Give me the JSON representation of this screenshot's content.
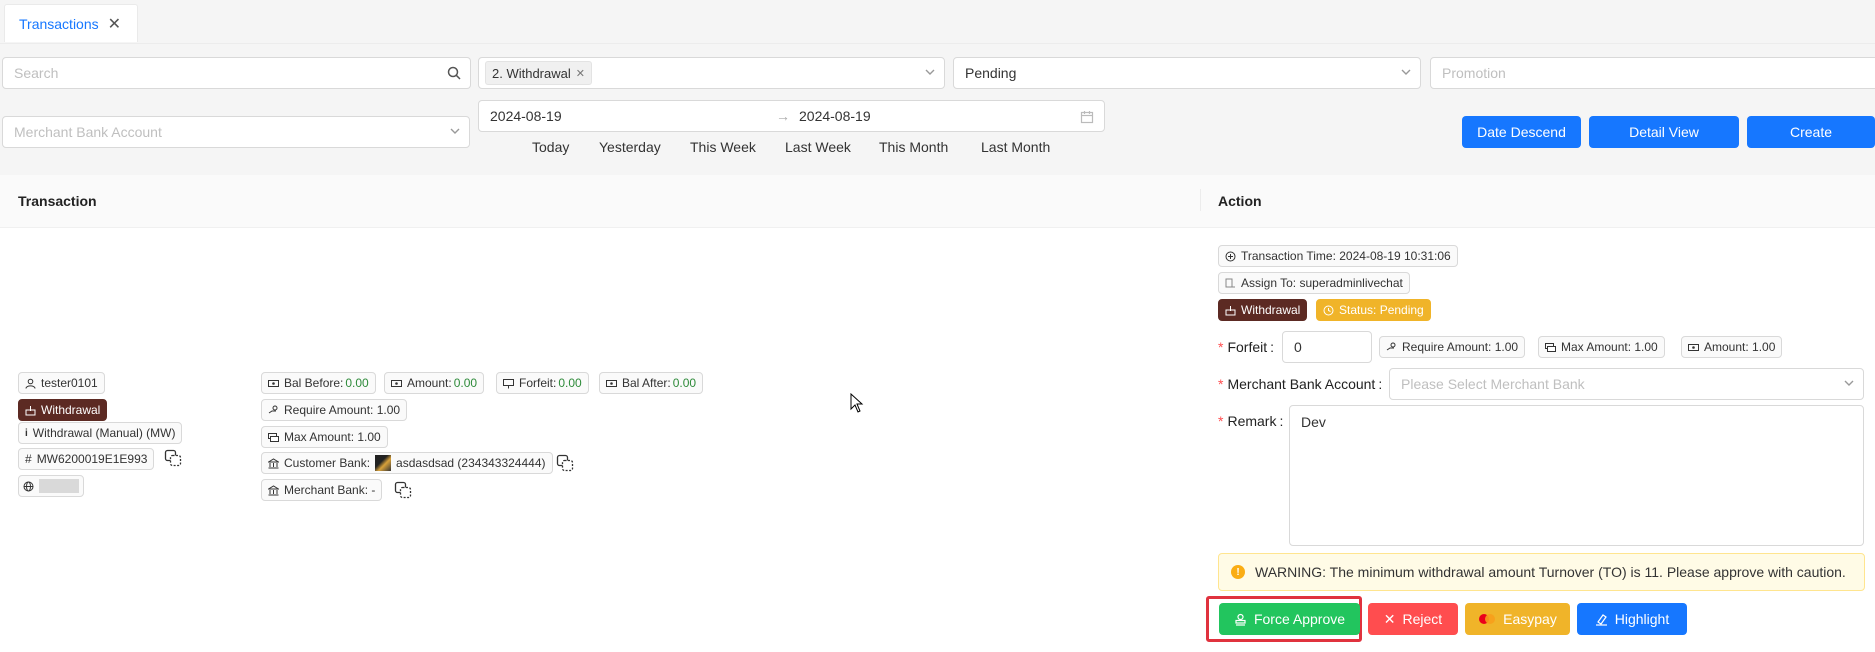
{
  "tab": {
    "label": "Transactions",
    "close": "✕"
  },
  "filters": {
    "search_placeholder": "Search",
    "type_tag": "2. Withdrawal",
    "status_value": "Pending",
    "promotion_placeholder": "Promotion",
    "merchant_bank_placeholder": "Merchant Bank Account",
    "date_from": "2024-08-19",
    "date_to": "2024-08-19",
    "date_sep": "→",
    "quick_ranges": [
      "Today",
      "Yesterday",
      "This Week",
      "Last Week",
      "This Month",
      "Last Month"
    ]
  },
  "toolbar": {
    "date_descend": "Date Descend",
    "detail_view": "Detail View",
    "create": "Create"
  },
  "table": {
    "col_transaction": "Transaction",
    "col_action": "Action"
  },
  "transaction": {
    "user": "tester0101",
    "type": "Withdrawal",
    "method": "Withdrawal (Manual) (MW)",
    "ref": "MW6200019E1E993",
    "bal_before_label": "Bal Before:",
    "bal_before": "0.00",
    "amount_label": "Amount:",
    "amount": "0.00",
    "forfeit_label": "Forfeit:",
    "forfeit": "0.00",
    "bal_after_label": "Bal After:",
    "bal_after": "0.00",
    "require_amount": "Require Amount: 1.00",
    "max_amount": "Max Amount: 1.00",
    "customer_bank_label": "Customer Bank:",
    "customer_bank": "asdasdsad (234343324444)",
    "merchant_bank": "Merchant Bank: -"
  },
  "action": {
    "time": "Transaction Time: 2024-08-19 10:31:06",
    "assign": "Assign To: superadminlivechat",
    "type_tag": "Withdrawal",
    "status_tag": "Status: Pending",
    "forfeit_label": "Forfeit",
    "forfeit_value": "0",
    "require_amount": "Require Amount: 1.00",
    "max_amount": "Max Amount: 1.00",
    "amount": "Amount: 1.00",
    "merchant_bank_label": "Merchant Bank Account",
    "merchant_bank_placeholder": "Please Select Merchant Bank",
    "remark_label": "Remark",
    "remark_value": "Dev",
    "colon": ":",
    "warning": "WARNING: The minimum withdrawal amount Turnover (TO) is 11. Please approve with caution.",
    "force_approve": "Force Approve",
    "reject": "Reject",
    "easypay": "Easypay",
    "highlight": "Highlight"
  },
  "colors": {
    "primary": "#1677ff",
    "success": "#22c55e",
    "danger": "#ff4d4f",
    "warning": "#f0b429",
    "withdrawal_tag": "#5c2a23",
    "highlight_frame": "#e0323e"
  }
}
